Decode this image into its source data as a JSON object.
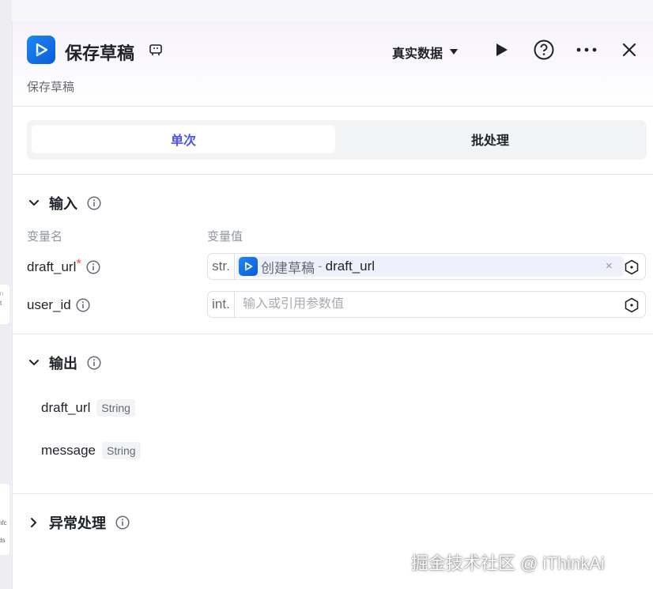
{
  "left_strip": {
    "card1": "in",
    "card1b": "t",
    "card2a": "nfc",
    "card2b": "ds"
  },
  "header": {
    "title": "保存草稿",
    "subtitle": "保存草稿",
    "data_mode": "真实数据"
  },
  "tabs": [
    {
      "label": "单次",
      "active": true
    },
    {
      "label": "批处理",
      "active": false
    }
  ],
  "input_section": {
    "title": "输入",
    "col_name": "变量名",
    "col_value": "变量值",
    "params": [
      {
        "name": "draft_url",
        "required_mark": "*",
        "type": "str.",
        "ref_node": "创建草稿",
        "ref_sep": "-",
        "ref_var": "draft_url",
        "clear": "×"
      },
      {
        "name": "user_id",
        "type": "int.",
        "placeholder": "输入或引用参数值"
      }
    ]
  },
  "output_section": {
    "title": "输出",
    "fields": [
      {
        "name": "draft_url",
        "type": "String"
      },
      {
        "name": "message",
        "type": "String"
      }
    ]
  },
  "error_section": {
    "title": "异常处理"
  },
  "watermark": "掘金技术社区 @ iThinkAi",
  "colors": {
    "accent": "#4d53e8",
    "logo": "#1e88f5",
    "required": "#f54a45"
  }
}
